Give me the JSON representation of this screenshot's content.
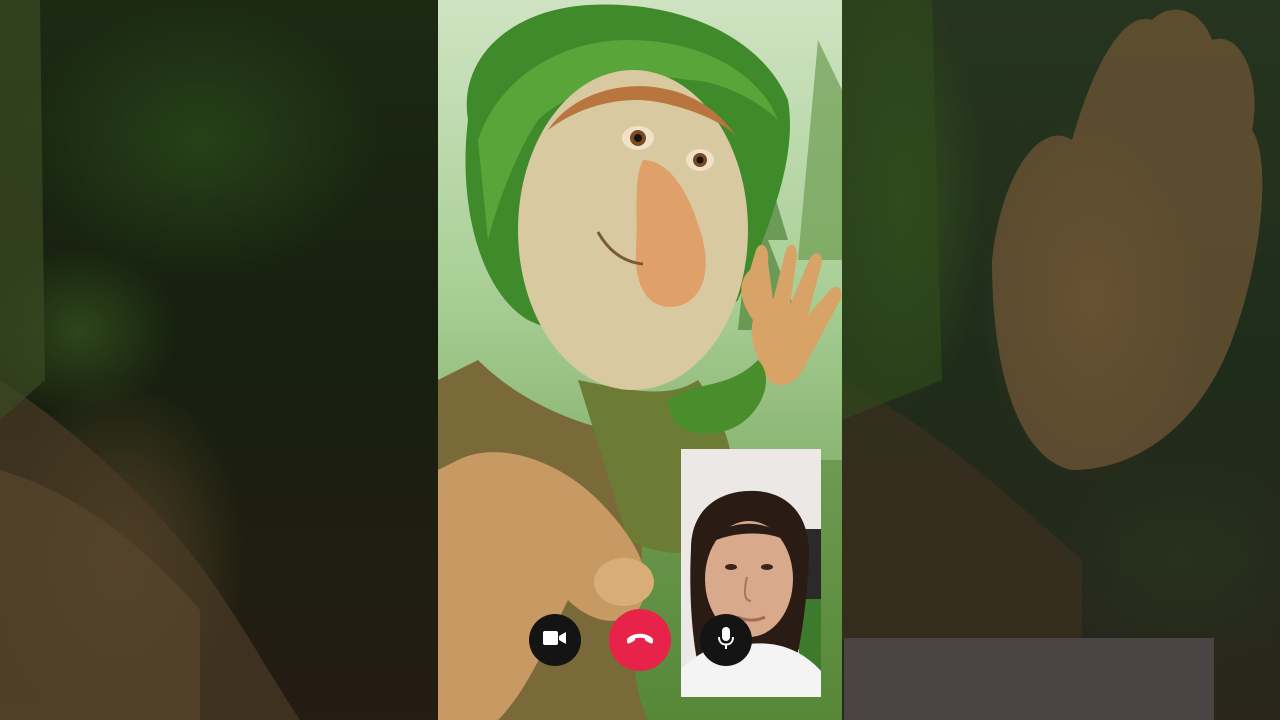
{
  "call": {
    "controls": {
      "video_icon": "video-camera-icon",
      "end_icon": "phone-hangup-icon",
      "mic_icon": "microphone-icon"
    },
    "colors": {
      "end_call": "#e8234a",
      "control_bg": "#141414",
      "icon": "#ffffff"
    }
  }
}
